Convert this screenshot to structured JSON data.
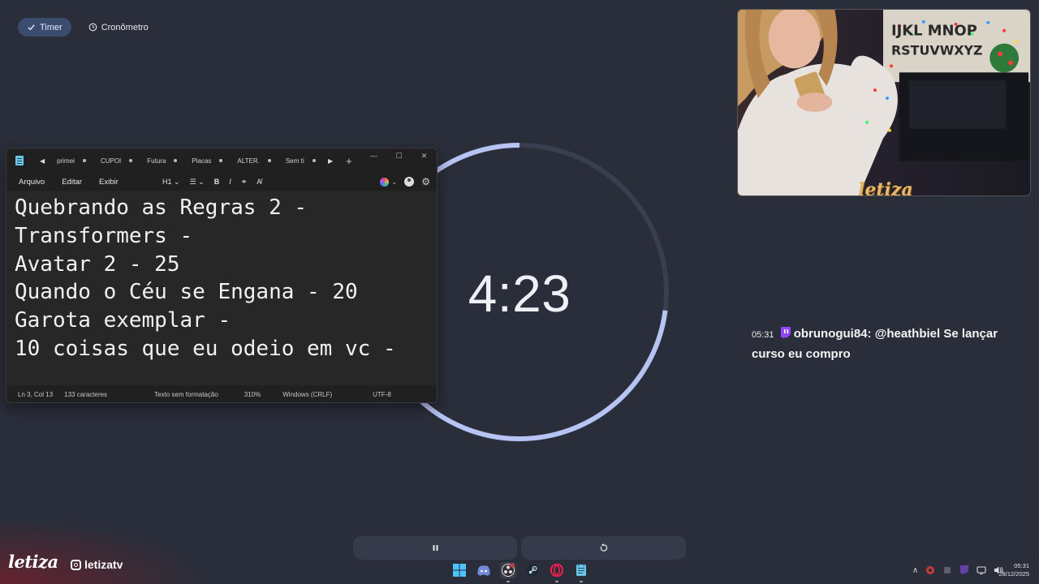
{
  "mode_tabs": {
    "timer": "Timer",
    "stopwatch": "Cronômetro"
  },
  "timer": {
    "display": "4:23",
    "progress_fraction": 0.73
  },
  "notepad": {
    "tabs": [
      "primei",
      "CUPOI",
      "Futura",
      "Placas",
      "ALTER.",
      "Sem tí"
    ],
    "menu": {
      "file": "Arquivo",
      "edit": "Editar",
      "view": "Exibir"
    },
    "heading_select": "H1",
    "content_lines": [
      "Quebrando as Regras 2 -",
      "Transformers -",
      "Avatar 2 - 25",
      "Quando o Céu se Engana - 20",
      "Garota exemplar -",
      "10 coisas que eu odeio em vc -"
    ],
    "status": {
      "position": "Ln 3, Col 13",
      "chars": "133 caracteres",
      "format": "Texto sem formatação",
      "zoom": "310%",
      "line_ending": "Windows (CRLF)",
      "encoding": "UTF-8"
    }
  },
  "webcam": {
    "logo": "letiza"
  },
  "chat": {
    "time": "05:31",
    "user": "obrunogui84",
    "message": ": @heathbiel Se lançar curso eu compro"
  },
  "branding": {
    "logo": "letiza",
    "instagram": "letizatv"
  },
  "clock": {
    "time": "05:31",
    "date": "28/12/2025"
  },
  "colors": {
    "background": "#2a2e3a",
    "ring_progress": "#b7c3f2",
    "ring_track": "#3a3f50",
    "active_tab": "#3b4d6e"
  }
}
